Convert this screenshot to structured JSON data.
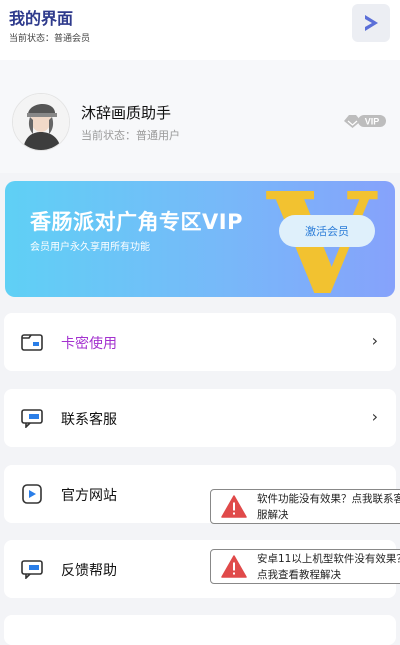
{
  "header": {
    "title": "我的界面",
    "subtitle": "当前状态：普通会员",
    "play_icon": "play-icon"
  },
  "profile": {
    "name": "沐辞画质助手",
    "status": "当前状态：普通用户",
    "badge": "VIP"
  },
  "banner": {
    "title": "香肠派对广角专区VIP",
    "subtitle": "会员用户永久享用所有功能",
    "button": "激活会员",
    "big_letter": "V"
  },
  "menu": [
    {
      "label": "卡密使用",
      "icon": "card-icon"
    },
    {
      "label": "联系客服",
      "icon": "chat-icon"
    },
    {
      "label": "官方网站",
      "icon": "video-icon"
    },
    {
      "label": "反馈帮助",
      "icon": "feedback-icon"
    }
  ],
  "toasts": [
    {
      "text": "软件功能没有效果？点我联系客服解决"
    },
    {
      "text": "安卓11以上机型软件没有效果？点我查看教程解决"
    }
  ],
  "colors": {
    "accent": "#2e3a8c",
    "purple": "#a331cf",
    "banner_start": "#5fd0f5",
    "banner_end": "#86a2fb",
    "gold": "#f2c230",
    "warning": "#e04a4a"
  }
}
